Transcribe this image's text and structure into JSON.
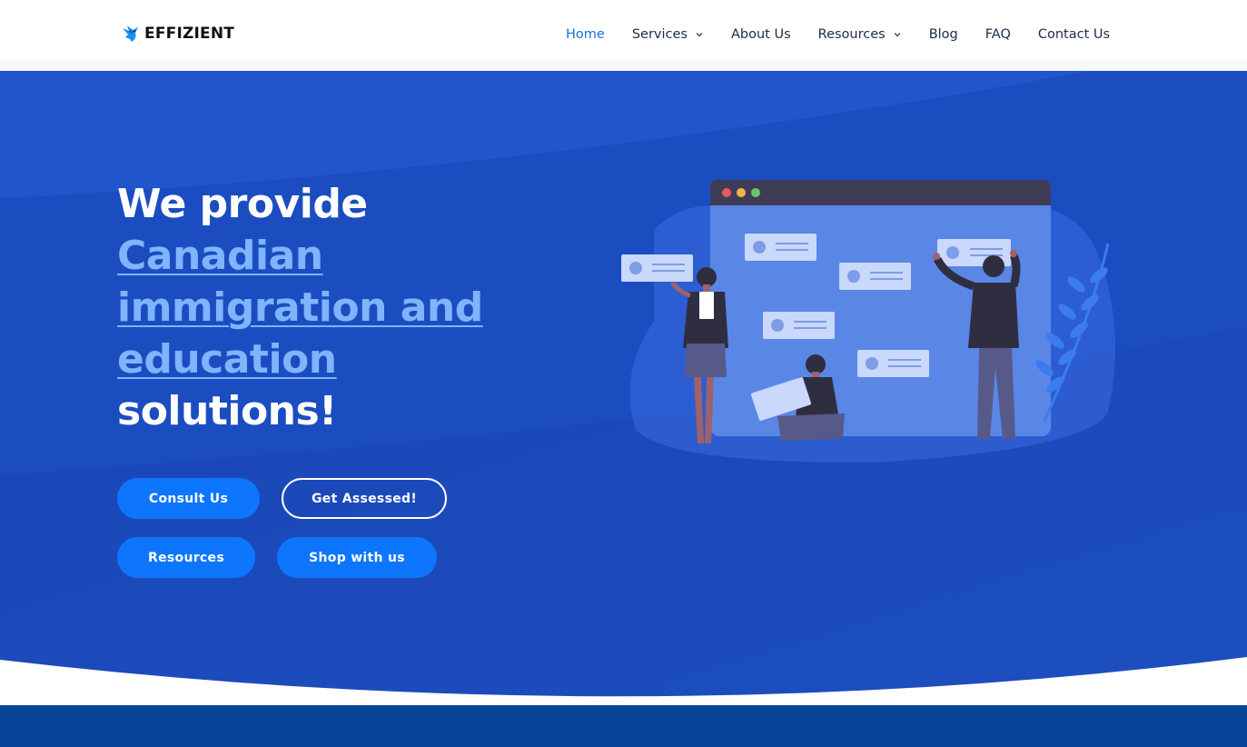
{
  "brand": {
    "name": "EFFIZIENT",
    "logo_icon": "bird-logo-icon"
  },
  "nav": {
    "items": [
      {
        "label": "Home",
        "active": true,
        "has_dropdown": false
      },
      {
        "label": "Services",
        "active": false,
        "has_dropdown": true
      },
      {
        "label": "About Us",
        "active": false,
        "has_dropdown": false
      },
      {
        "label": "Resources",
        "active": false,
        "has_dropdown": true
      },
      {
        "label": "Blog",
        "active": false,
        "has_dropdown": false
      },
      {
        "label": "FAQ",
        "active": false,
        "has_dropdown": false
      },
      {
        "label": "Contact Us",
        "active": false,
        "has_dropdown": false
      }
    ]
  },
  "hero": {
    "title_line1": "We provide",
    "title_accent_1": "Canadian",
    "title_accent_2": "immigration and",
    "title_accent_3": "education",
    "title_line_end": "solutions!",
    "buttons": {
      "consult": "Consult Us",
      "assessed": "Get Assessed!",
      "resources": "Resources",
      "shop": "Shop with us"
    },
    "illustration": "team-collaboration-illustration"
  },
  "colors": {
    "hero_bg": "#1b4dc0",
    "accent_text": "#7fb4ff",
    "button": "#0e76fd",
    "nav_active": "#1a6fd8",
    "bottom_band": "#064597"
  }
}
